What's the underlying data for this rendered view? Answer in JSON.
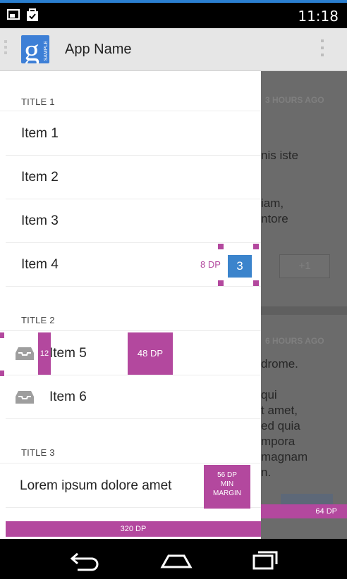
{
  "status_bar": {
    "time": "11:18"
  },
  "action_bar": {
    "app_name": "App Name",
    "icon_letter": "g",
    "icon_caption": "SAMPLE"
  },
  "drawer": {
    "sections": [
      {
        "title": "TITLE 1",
        "items": [
          "Item 1",
          "Item 2",
          "Item 3",
          "Item 4"
        ]
      },
      {
        "title": "TITLE 2",
        "items": [
          "Item 5",
          "Item 6"
        ]
      },
      {
        "title": "TITLE 3",
        "items": [
          "Lorem ipsum dolore amet"
        ]
      }
    ],
    "item4_badge": "3"
  },
  "background_content": {
    "card1_stamp": "3 HOURS AGO",
    "card1_lines": [
      "nis iste",
      "iam,",
      "ntore"
    ],
    "card1_button": "+1",
    "card2_stamp": "6 HOURS AGO",
    "card2_lines": [
      "drome.",
      "qui",
      "t amet,",
      "ed quia",
      "mpora",
      "magnam",
      "n."
    ]
  },
  "spec_annotations": {
    "badge_margin": "8 DP",
    "icon_gap": "12",
    "item_height": "48 DP",
    "min_margin": [
      "56 DP",
      "MIN",
      "MARGIN"
    ],
    "right_width": "64 DP",
    "drawer_width": "320 DP"
  },
  "colors": {
    "spec": "#b3489e",
    "badge": "#3b84cc",
    "app_icon": "#3d7fd6"
  },
  "icons": [
    "image-icon",
    "bag-icon",
    "drawer-indicator-icon",
    "overflow-menu-icon",
    "inbox-icon",
    "back-icon",
    "home-icon",
    "recents-icon"
  ]
}
